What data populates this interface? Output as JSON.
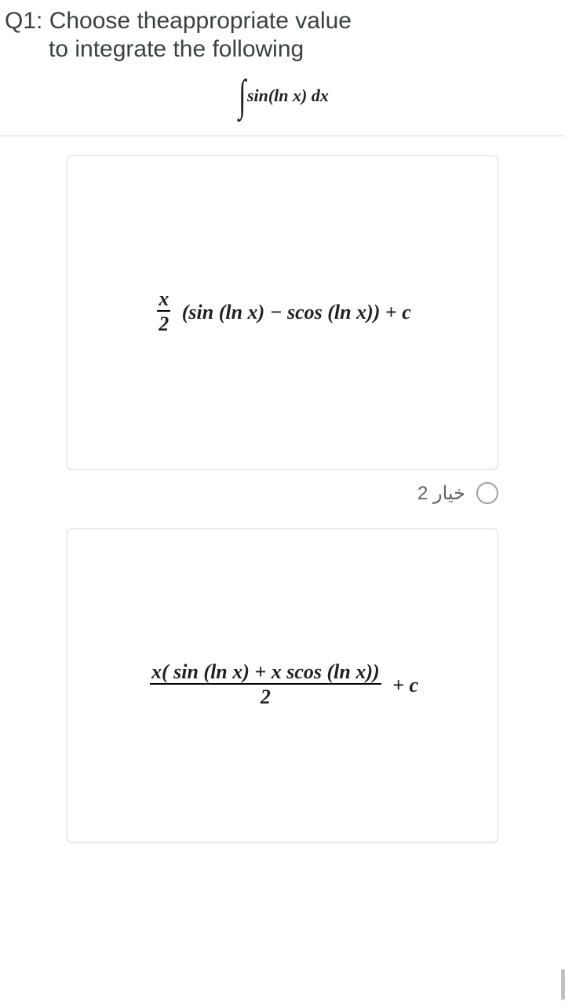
{
  "question": {
    "number": "Q1:",
    "line1": "Choose theappropriate value",
    "line2": "to integrate the following",
    "integral": "sin(ln x)  dx"
  },
  "options": {
    "opt1": {
      "frac_num": "x",
      "frac_den": "2",
      "body": "(sin (ln x) −  scos (ln x)) + c"
    },
    "radio2_label": "خيار 2",
    "opt2": {
      "frac_num": "x( sin (ln x) + x scos (ln x))",
      "frac_den": "2",
      "tail": "+ c"
    }
  }
}
